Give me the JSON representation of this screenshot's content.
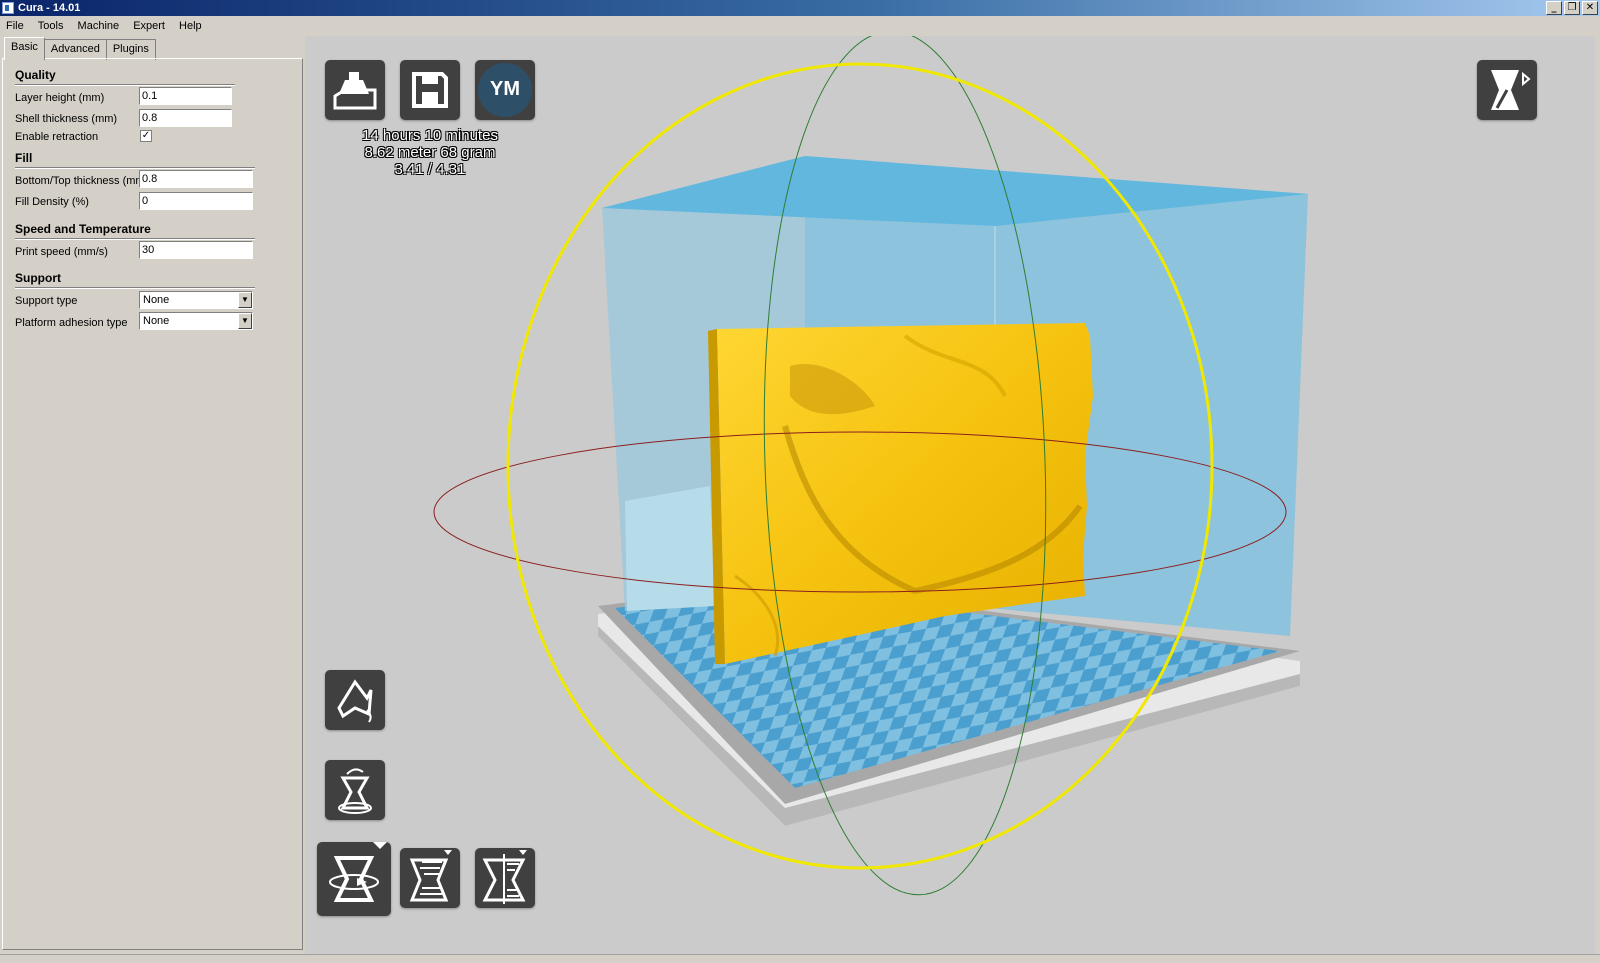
{
  "window": {
    "title": "Cura - 14.01",
    "min": "_",
    "restore": "❐",
    "close": "✕"
  },
  "menu": [
    "File",
    "Tools",
    "Machine",
    "Expert",
    "Help"
  ],
  "tabs": [
    {
      "label": "Basic"
    },
    {
      "label": "Advanced"
    },
    {
      "label": "Plugins"
    }
  ],
  "settings": {
    "quality": {
      "title": "Quality",
      "layer_height_label": "Layer height (mm)",
      "layer_height": "0.1",
      "shell_thickness_label": "Shell thickness (mm)",
      "shell_thickness": "0.8",
      "retraction_label": "Enable retraction",
      "retraction_checked": "✓"
    },
    "fill": {
      "title": "Fill",
      "bottom_top_label": "Bottom/Top thickness (mm)",
      "bottom_top": "0.8",
      "density_label": "Fill Density (%)",
      "density": "0"
    },
    "speed": {
      "title": "Speed and Temperature",
      "print_speed_label": "Print speed (mm/s)",
      "print_speed": "30"
    },
    "support": {
      "title": "Support",
      "support_type_label": "Support type",
      "support_type": "None",
      "adhesion_label": "Platform adhesion type",
      "adhesion": "None"
    }
  },
  "print_info": {
    "time": "14 hours 10 minutes",
    "material": "8.62 meter 68 gram",
    "cost": "3.41 / 4.31"
  },
  "toolbar": {
    "ym_label": "YM"
  },
  "icons": {
    "load": "load-model-icon",
    "save": "save-icon",
    "ym": "youmagine-icon",
    "view": "view-mode-icon",
    "rotate": "rotate-tool-icon",
    "lay_flat": "lay-flat-icon",
    "scale": "scale-tool-icon",
    "mirror": "mirror-tool-icon",
    "reset": "reset-icon"
  },
  "colors": {
    "model": "#f8c81a",
    "build_volume": "#5ab4de",
    "bed_checker": "#4a9fcf"
  }
}
